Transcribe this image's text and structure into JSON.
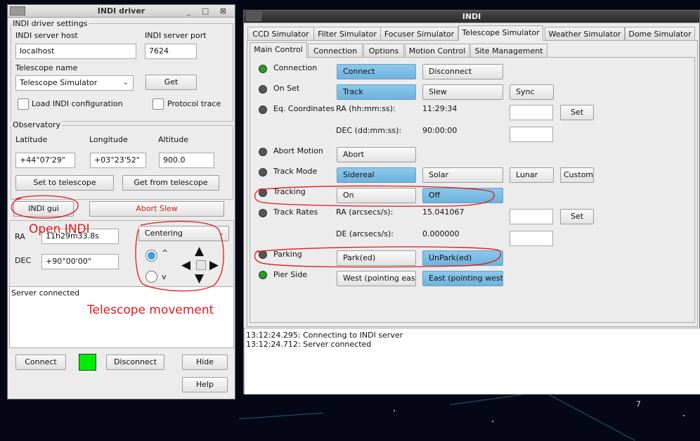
{
  "driver_window": {
    "title": "INDI driver",
    "title_buttons": "_ □ ⊠",
    "settings_group": "INDI driver settings",
    "host_label": "INDI server host",
    "host_value": "localhost",
    "port_label": "INDI server port",
    "port_value": "7624",
    "telescope_label": "Telescope name",
    "telescope_value": "Telescope Simulator",
    "get_button": "Get",
    "load_config_label": "Load INDI configuration",
    "protocol_trace_label": "Protocol trace",
    "observatory_group": "Observatory",
    "latitude_label": "Latitude",
    "longitude_label": "Longitude",
    "altitude_label": "Altitude",
    "latitude_value": "+44°07'29\"",
    "longitude_value": "+03°23'52\"",
    "altitude_value": "900.0",
    "set_to_telescope": "Set to telescope",
    "get_from_telescope": "Get from telescope",
    "indi_gui_button": "INDI gui",
    "abort_slew_button": "Abort Slew",
    "ra_label": "RA",
    "ra_value": "11h29m33.8s",
    "dec_label": "DEC",
    "dec_value": "+90°00'00\"",
    "centering_value": "Centering",
    "radio_up": "^",
    "radio_down": "v",
    "status_text": "Server connected",
    "connect_button": "Connect",
    "disconnect_button": "Disconnect",
    "hide_button": "Hide",
    "help_button": "Help",
    "status_color": "#00ee00"
  },
  "indi_window": {
    "title": "INDI",
    "device_tabs": [
      "CCD Simulator",
      "Filter Simulator",
      "Focuser Simulator",
      "Telescope Simulator",
      "Weather Simulator",
      "Dome Simulator"
    ],
    "group_tabs": [
      "Main Control",
      "Connection",
      "Options",
      "Motion Control",
      "Site Management"
    ],
    "props": {
      "connection": {
        "label": "Connection",
        "on": "Connect",
        "off": "Disconnect"
      },
      "on_set": {
        "label": "On Set",
        "b1": "Track",
        "b2": "Slew",
        "b3": "Sync"
      },
      "eq": {
        "label": "Eq. Coordinates",
        "ra_label": "RA (hh:mm:ss):",
        "ra_value": "11:29:34",
        "dec_label": "DEC (dd:mm:ss):",
        "dec_value": "90:00:00",
        "set": "Set"
      },
      "abort": {
        "label": "Abort Motion",
        "b1": "Abort"
      },
      "track_mode": {
        "label": "Track Mode",
        "b1": "Sidereal",
        "b2": "Solar",
        "b3": "Lunar",
        "b4": "Custom"
      },
      "tracking": {
        "label": "Tracking",
        "b1": "On",
        "b2": "Off"
      },
      "track_rates": {
        "label": "Track Rates",
        "ra_label": "RA (arcsecs/s):",
        "ra_value": "15.041067",
        "de_label": "DE (arcsecs/s):",
        "de_value": "0.000000",
        "set": "Set"
      },
      "parking": {
        "label": "Parking",
        "b1": "Park(ed)",
        "b2": "UnPark(ed)"
      },
      "pier": {
        "label": "Pier Side",
        "b1": "West (pointing east)",
        "b2": "East (pointing west)"
      }
    },
    "log_lines": [
      "13:12:24.295: Connecting to INDI server",
      "13:12:24.712: Server connected"
    ],
    "led_ok": "#22a022",
    "led_idle": "#555555",
    "accent": "#7bbde6"
  },
  "annotations": {
    "open_indi": "Open INDI",
    "telescope_movement": "Telescope movement",
    "color": "#e0191b"
  },
  "sky_labels": {
    "label_7": "7"
  }
}
